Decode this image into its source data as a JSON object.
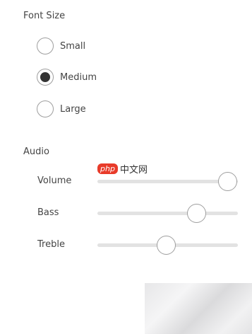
{
  "font_size": {
    "title": "Font Size",
    "options": [
      {
        "label": "Small",
        "checked": false
      },
      {
        "label": "Medium",
        "checked": true
      },
      {
        "label": "Large",
        "checked": false
      }
    ]
  },
  "audio": {
    "title": "Audio",
    "sliders": [
      {
        "label": "Volume",
        "value": 0.93
      },
      {
        "label": "Bass",
        "value": 0.71
      },
      {
        "label": "Treble",
        "value": 0.49
      }
    ]
  },
  "watermark": {
    "badge": "php",
    "text": "中文网"
  },
  "colors": {
    "selected_dot": "#333333",
    "border": "#9e9e9e",
    "track": "#e2e2e2",
    "watermark_red": "#e83b2a"
  }
}
